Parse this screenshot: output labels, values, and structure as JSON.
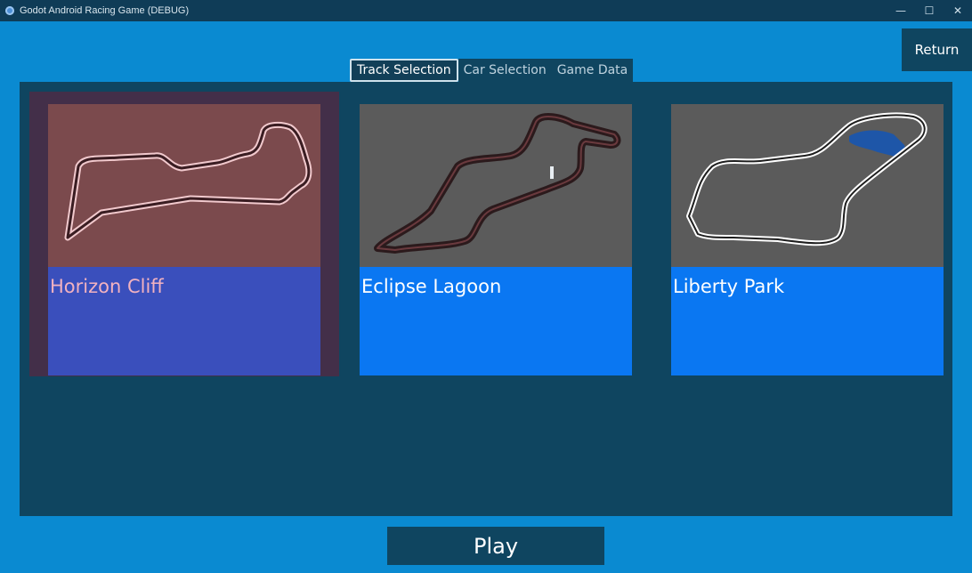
{
  "window": {
    "title": "Godot Android Racing Game (DEBUG)",
    "minimize_glyph": "—",
    "maximize_glyph": "☐",
    "close_glyph": "✕"
  },
  "header": {
    "return_label": "Return"
  },
  "tabs": [
    {
      "label": "Track Selection",
      "active": true
    },
    {
      "label": "Car Selection",
      "active": false
    },
    {
      "label": "Game Data",
      "active": false
    }
  ],
  "tracks": [
    {
      "name": "Horizon Cliff",
      "selected": true,
      "icon": "track-map-icon"
    },
    {
      "name": "Eclipse Lagoon",
      "selected": false,
      "icon": "track-map-icon"
    },
    {
      "name": "Liberty Park",
      "selected": false,
      "icon": "track-map-icon"
    }
  ],
  "footer": {
    "play_label": "Play"
  },
  "colors": {
    "background": "#0a8ad1",
    "panel": "#0f4560",
    "card_label": "#0a77f2",
    "selected_label": "#3a4fbc",
    "selected_thumb": "#7b4a4d"
  }
}
